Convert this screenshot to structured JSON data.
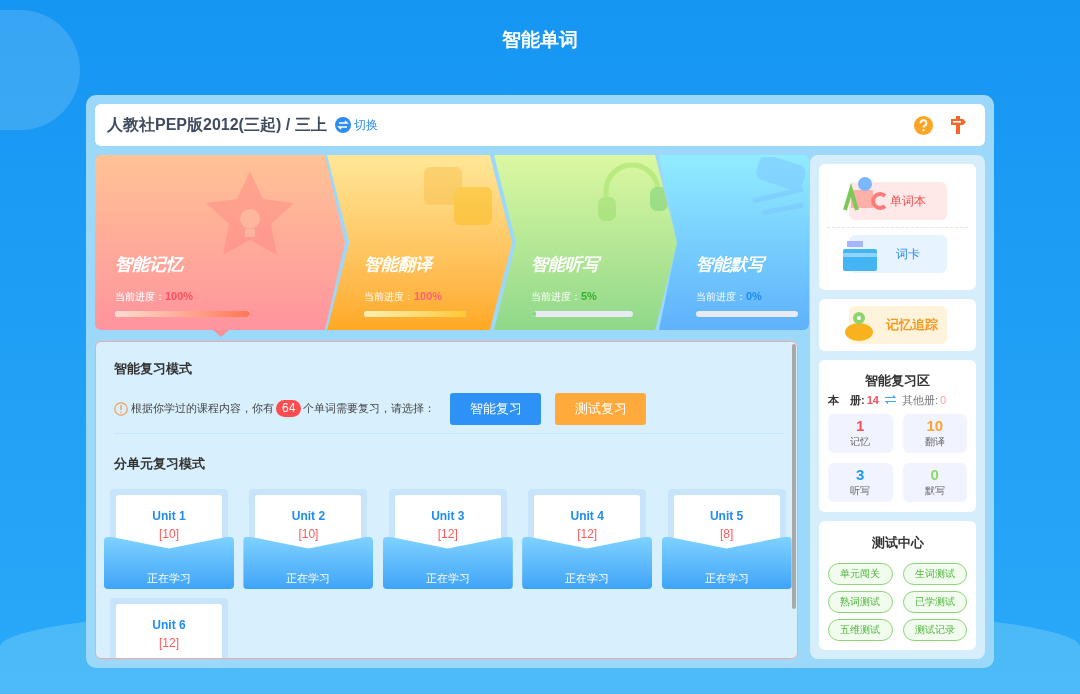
{
  "page_title": "智能单词",
  "header": {
    "book": "人教社PEP版2012(三起) / 三上",
    "switch_label": "切换"
  },
  "modes": [
    {
      "kind": "memory",
      "title": "智能记忆",
      "progress_label": "当前进度：",
      "progress": "100%",
      "level": 1,
      "selected": true
    },
    {
      "kind": "translate",
      "title": "智能翻译",
      "progress_label": "当前进度：",
      "progress": "100%",
      "level": 1,
      "selected": false
    },
    {
      "kind": "listen",
      "title": "智能听写",
      "progress_label": "当前进度：",
      "progress": "5%",
      "level": 0.05,
      "selected": false
    },
    {
      "kind": "dictate",
      "title": "智能默写",
      "progress_label": "当前进度：",
      "progress": "0%",
      "level": 0,
      "selected": false
    }
  ],
  "smart_review": {
    "heading": "智能复习模式",
    "text_before": "根据你学过的课程内容，你有",
    "count": "64",
    "text_after": "个单词需要复习，请选择：",
    "buttons": [
      {
        "kind": "primary",
        "label": "智能复习"
      },
      {
        "kind": "secondary",
        "label": "测试复习"
      }
    ]
  },
  "unit_review": {
    "heading": "分单元复习模式",
    "units": [
      {
        "name": "Unit 1",
        "count": "[10]",
        "status": "正在学习"
      },
      {
        "name": "Unit 2",
        "count": "[10]",
        "status": "正在学习"
      },
      {
        "name": "Unit 3",
        "count": "[12]",
        "status": "正在学习"
      },
      {
        "name": "Unit 4",
        "count": "[12]",
        "status": "正在学习"
      },
      {
        "name": "Unit 5",
        "count": "[8]",
        "status": "正在学习"
      },
      {
        "name": "Unit 6",
        "count": "[12]"
      }
    ]
  },
  "sidebar": {
    "tools": [
      {
        "kind": "wordbook",
        "label": "单词本"
      },
      {
        "kind": "cards",
        "label": "词卡"
      }
    ],
    "tracking": {
      "label": "记忆追踪"
    },
    "review_area": {
      "title": "智能复习区",
      "this_label": "本　册:",
      "this_count": "14",
      "other_label": "其他册:",
      "other_count": "0",
      "stats": [
        {
          "value": "1",
          "label": "记忆",
          "color": "#ff4d5a"
        },
        {
          "value": "10",
          "label": "翻译",
          "color": "#ffa133"
        },
        {
          "value": "3",
          "label": "听写",
          "color": "#1e9bf0"
        },
        {
          "value": "0",
          "label": "默写",
          "color": "#8fd96b"
        }
      ]
    },
    "test_center": {
      "title": "测试中心",
      "buttons": [
        "单元闯关",
        "生词测试",
        "熟词测试",
        "已学测试",
        "五维测试",
        "测试记录"
      ]
    }
  }
}
